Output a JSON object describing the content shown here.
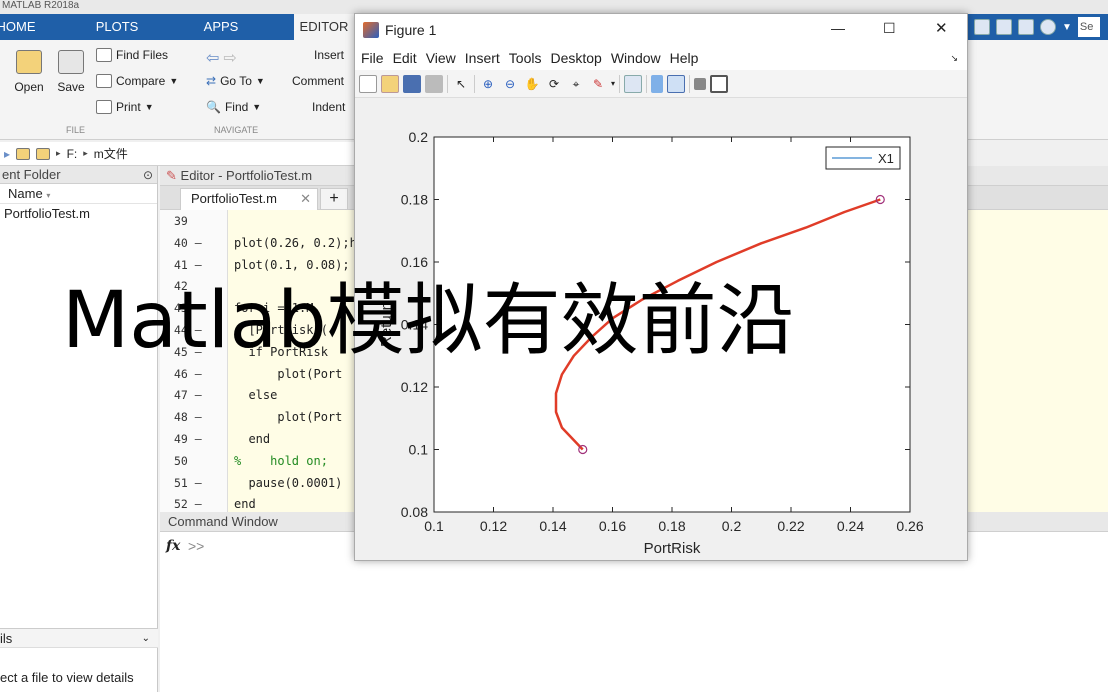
{
  "app": {
    "title": "MATLAB R2018a"
  },
  "toolstrip": {
    "tabs": [
      {
        "label": "HOME"
      },
      {
        "label": "PLOTS"
      },
      {
        "label": "APPS"
      },
      {
        "label": "EDITOR"
      }
    ],
    "search_placeholder": "Se"
  },
  "ribbon": {
    "open": "Open",
    "save": "Save",
    "find_files": "Find Files",
    "compare": "Compare",
    "print": "Print",
    "go_to": "Go To",
    "find": "Find",
    "insert": "Insert",
    "comment": "Comment",
    "indent": "Indent",
    "group_file": "FILE",
    "group_navigate": "NAVIGATE"
  },
  "address": {
    "drive": "F:",
    "folder": "m文件"
  },
  "current_folder": {
    "title": "ent Folder",
    "column": "Name",
    "files": [
      {
        "name": "PortfolioTest.m"
      }
    ],
    "details_title": "ils",
    "details_text": "ect a file to view details"
  },
  "editor": {
    "header": "Editor - PortfolioTest.m",
    "tab": "PortfolioTest.m",
    "lines": [
      {
        "num": "39",
        "dash": "",
        "code": ""
      },
      {
        "num": "40",
        "dash": "—",
        "code": "plot(0.26, 0.2);h"
      },
      {
        "num": "41",
        "dash": "—",
        "code": "plot(0.1, 0.08);"
      },
      {
        "num": "42",
        "dash": "",
        "code": ""
      },
      {
        "num": "43",
        "dash": "—",
        "code": "for i = 1:M"
      },
      {
        "num": "44",
        "dash": "—",
        "code": "  [PortRisk1("
      },
      {
        "num": "45",
        "dash": "—",
        "code": "  if PortRisk"
      },
      {
        "num": "46",
        "dash": "—",
        "code": "      plot(Port"
      },
      {
        "num": "47",
        "dash": "—",
        "code": "  else"
      },
      {
        "num": "48",
        "dash": "—",
        "code": "      plot(Port"
      },
      {
        "num": "49",
        "dash": "—",
        "code": "  end"
      },
      {
        "num": "50",
        "dash": "",
        "code": "%    hold on;"
      },
      {
        "num": "51",
        "dash": "—",
        "code": "  pause(0.0001)"
      },
      {
        "num": "52",
        "dash": "—",
        "code": "end"
      }
    ]
  },
  "command_window": {
    "title": "Command Window",
    "fx": "fx",
    "prompt": ">>"
  },
  "figure": {
    "title": "Figure 1",
    "menu": [
      "File",
      "Edit",
      "View",
      "Insert",
      "Tools",
      "Desktop",
      "Window",
      "Help"
    ],
    "window_buttons": {
      "minimize": "—",
      "maximize": "☐",
      "close": "✕"
    }
  },
  "chart_data": {
    "type": "line",
    "xlabel": "PortRisk",
    "ylabel": "Return",
    "xlim": [
      0.1,
      0.26
    ],
    "ylim": [
      0.08,
      0.2
    ],
    "xticks": [
      "0.1",
      "0.12",
      "0.14",
      "0.16",
      "0.18",
      "0.2",
      "0.22",
      "0.24",
      "0.26"
    ],
    "yticks": [
      "0.08",
      "0.1",
      "0.12",
      "0.14",
      "0.16",
      "0.18",
      "0.2"
    ],
    "legend": {
      "entries": [
        "X1"
      ],
      "location": "top-right"
    },
    "series": [
      {
        "name": "X1",
        "color": "#e03c28",
        "x": [
          0.15,
          0.147,
          0.143,
          0.141,
          0.141,
          0.143,
          0.147,
          0.153,
          0.16,
          0.17,
          0.182,
          0.195,
          0.21,
          0.225,
          0.238,
          0.25
        ],
        "y": [
          0.1,
          0.103,
          0.107,
          0.112,
          0.118,
          0.124,
          0.13,
          0.136,
          0.142,
          0.148,
          0.154,
          0.16,
          0.166,
          0.171,
          0.176,
          0.18
        ]
      }
    ],
    "markers": [
      {
        "x": 0.15,
        "y": 0.1,
        "color": "#a0307a"
      },
      {
        "x": 0.25,
        "y": 0.18,
        "color": "#a0307a"
      }
    ]
  },
  "overlay": {
    "text": "Matlab模拟有效前沿"
  }
}
